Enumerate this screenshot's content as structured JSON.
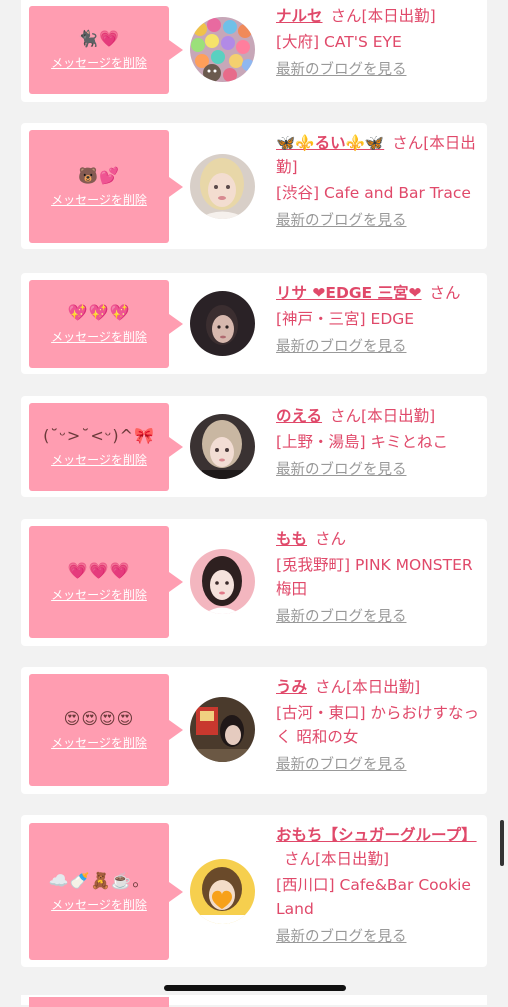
{
  "delete_label": "メッセージを削除",
  "blog_label": "最新のブログを見る",
  "colors": {
    "accent": "#e0496a",
    "pink_box": "#ff9db1",
    "link_gray": "#999999",
    "background": "#f2f2f2"
  },
  "entries": [
    {
      "emoji": "🐈‍⬛💗",
      "name": "ナルセ",
      "suffix": "さん[本日出勤]",
      "shop": "[大府] CAT'S EYE"
    },
    {
      "emoji": "🐻💕",
      "name": "🦋⚜️るい⚜️🦋",
      "suffix": "さん[本日出勤]",
      "shop": "[渋谷] Cafe and Bar Trace"
    },
    {
      "emoji": "💖💖💖",
      "name": "リサ ❤EDGE 三宮❤",
      "suffix": "さん",
      "shop": "[神戸・三宮] EDGE"
    },
    {
      "emoji": "(˘ᵕ>˘<ᵕ)^🎀",
      "name": "のえる",
      "suffix": "さん[本日出勤]",
      "shop": "[上野・湯島] キミとねこ"
    },
    {
      "emoji": "💗💗💗",
      "name": "もも",
      "suffix": "さん",
      "shop": "[兎我野町] PINK MONSTER梅田"
    },
    {
      "emoji": "😍😍😍😍",
      "name": "うみ",
      "suffix": "さん[本日出勤]",
      "shop": "[古河・東口] からおけすなっく 昭和の女"
    },
    {
      "emoji": "☁️🍼🧸☕️。",
      "name": "おもち【シュガーグループ】",
      "suffix": "さん[本日出勤]",
      "shop": "[西川口] Cafe&Bar Cookie Land"
    }
  ]
}
